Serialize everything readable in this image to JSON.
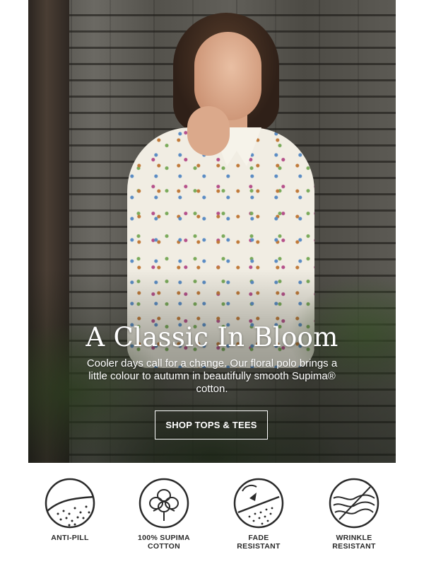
{
  "hero": {
    "headline": "A Classic In Bloom",
    "subcopy": "Cooler days call for a change. Our floral polo brings a little colour to autumn in beautifully smooth Supima® cotton.",
    "cta_label": "SHOP TOPS & TEES"
  },
  "features": [
    {
      "icon": "anti-pill-icon",
      "label": "ANTI-PILL"
    },
    {
      "icon": "cotton-boll-icon",
      "label": "100% SUPIMA\nCOTTON"
    },
    {
      "icon": "fade-resistant-icon",
      "label": "FADE\nRESISTANT"
    },
    {
      "icon": "wrinkle-resistant-icon",
      "label": "WRINKLE\nRESISTANT"
    }
  ],
  "colors": {
    "text_light": "#ffffff",
    "icon_stroke": "#2a2a2a"
  }
}
